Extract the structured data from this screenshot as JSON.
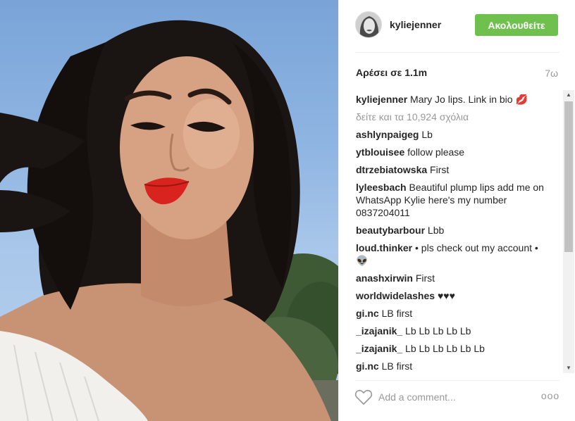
{
  "post": {
    "photo_alt_icon": "selfie-photo",
    "accent_color": "#70c050"
  },
  "header": {
    "username": "kyliejenner",
    "follow_label": "Ακολουθείτε"
  },
  "stats": {
    "likes": "Αρέσει σε 1.1m",
    "time": "7ω"
  },
  "caption": {
    "username": "kyliejenner",
    "text": "Mary Jo lips. Link in bio 💋"
  },
  "view_all_comments": "δείτε και τα 10,924 σχόλια",
  "comments": [
    {
      "username": "ashlynpaigeg",
      "text": "Lb"
    },
    {
      "username": "ytblouisee",
      "text": "follow please"
    },
    {
      "username": "dtrzebiatowska",
      "text": "First"
    },
    {
      "username": "lyleesbach",
      "text": "Beautiful plump lips add me on WhatsApp Kylie here's my number 0837204011"
    },
    {
      "username": "beautybarbour",
      "text": "Lbb"
    },
    {
      "username": "loud.thinker",
      "text": "• pls check out my account • 👽"
    },
    {
      "username": "anashxirwin",
      "text": "First"
    },
    {
      "username": "worldwidelashes",
      "text": "♥♥♥"
    },
    {
      "username": "gi.nc",
      "text": "LB first"
    },
    {
      "username": "_izajanik_",
      "text": "Lb Lb Lb Lb Lb"
    },
    {
      "username": "_izajanik_",
      "text": "Lb Lb Lb Lb Lb Lb"
    },
    {
      "username": "gi.nc",
      "text": "LB first"
    }
  ],
  "footer": {
    "comment_placeholder": "Add a comment...",
    "more_label": "ooo"
  }
}
